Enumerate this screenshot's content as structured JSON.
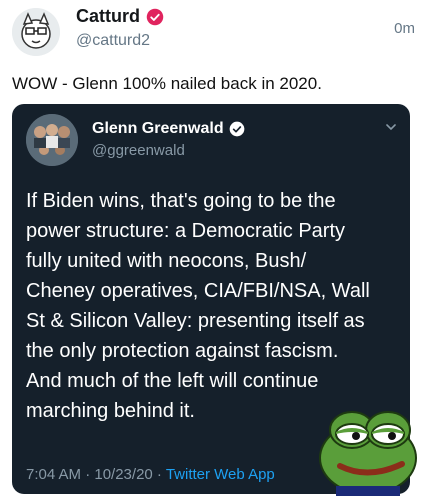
{
  "tweet": {
    "display_name": "Catturd",
    "handle": "@catturd2",
    "time": "0m",
    "text": "WOW - Glenn 100% nailed back in 2020."
  },
  "quoted": {
    "display_name": "Glenn Greenwald",
    "handle": "@ggreenwald",
    "body": "If Biden wins, that's going to be the\npower structure: a Democratic Party\nfully united with neocons, Bush/\nCheney operatives, CIA/FBI/NSA, Wall\nSt & Silicon Valley: presenting itself as\nthe only protection against fascism.\nAnd much of the left will continue\nmarching behind it.",
    "timestamp": "7:04 AM · 10/23/20 · ",
    "source_app": "Twitter Web App"
  },
  "colors": {
    "verified": "#e0245e",
    "quote_bg": "#15202b",
    "link": "#1da1f2"
  },
  "icons": [
    "verified-badge-icon",
    "chevron-down-icon"
  ]
}
